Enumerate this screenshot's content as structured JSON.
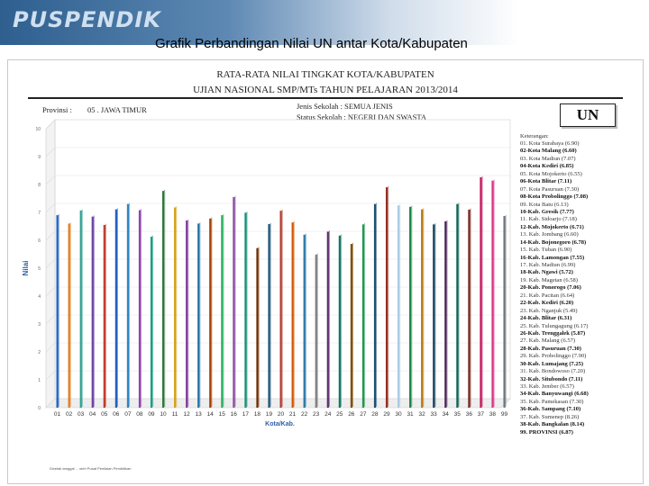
{
  "header": {
    "brand": "PUSPENDIK",
    "slide_title": "Grafik Perbandingan Nilai UN antar Kota/Kabupaten"
  },
  "report": {
    "title_line1": "RATA-RATA NILAI TINGKAT KOTA/KABUPATEN",
    "title_line2": "UJIAN NASIONAL SMP/MTs TAHUN PELAJARAN 2013/2014",
    "province_label": "Provinsi :",
    "province_value": "05 . JAWA TIMUR",
    "school_type": "Jenis Sekolah : SEMUA JENIS",
    "school_status": "Status Sekolah : NEGERI DAN SWASTA",
    "badge": "UN",
    "legend_heading": "Keterangan:",
    "footer_note": "Dicetak tanggal ... oleh Pusat Penilaian Pendidikan"
  },
  "chart_data": {
    "type": "bar",
    "ylabel": "Nilai",
    "xlabel": "Kota/Kab.",
    "ylim": [
      0,
      10
    ],
    "yticks": [
      0,
      1,
      2,
      3,
      4,
      5,
      6,
      7,
      8,
      9,
      10
    ],
    "grid": true,
    "legend_position": "right",
    "categories": [
      "01",
      "02",
      "03",
      "04",
      "05",
      "06",
      "07",
      "08",
      "09",
      "10",
      "11",
      "12",
      "13",
      "14",
      "15",
      "16",
      "17",
      "18",
      "19",
      "20",
      "21",
      "22",
      "23",
      "24",
      "25",
      "26",
      "27",
      "28",
      "29",
      "30",
      "31",
      "32",
      "33",
      "34",
      "35",
      "36",
      "37",
      "38",
      "99"
    ],
    "values": [
      6.9,
      6.6,
      7.07,
      6.85,
      6.55,
      7.11,
      7.3,
      7.08,
      6.13,
      7.77,
      7.18,
      6.71,
      6.6,
      6.78,
      6.9,
      7.55,
      6.99,
      5.72,
      6.58,
      7.06,
      6.64,
      6.2,
      5.49,
      6.31,
      6.17,
      5.87,
      6.57,
      7.3,
      7.9,
      7.25,
      7.2,
      7.11,
      6.57,
      6.68,
      7.3,
      7.1,
      8.26,
      8.14,
      6.87
    ],
    "legend": [
      "01. Kota Surabaya (6.90)",
      "02-Kota Malang (6.60)",
      "03. Kota Madiun (7.07)",
      "04-Kota Kediri (6.85)",
      "05. Kota Mojokerto (6.55)",
      "06-Kota Blitar (7.11)",
      "07. Kota Pasuruan (7.30)",
      "08-Kota Probolinggo (7.08)",
      "09. Kota Batu (6.13)",
      "10-Kab. Gresik (7.77)",
      "11. Kab. Sidoarjo (7.18)",
      "12-Kab. Mojokerto (6.71)",
      "13. Kab. Jombang (6.60)",
      "14-Kab. Bojonegoro (6.78)",
      "15. Kab. Tuban (6.90)",
      "16-Kab. Lamongan (7.55)",
      "17. Kab. Madiun (6.99)",
      "18-Kab. Ngawi (5.72)",
      "19. Kab. Magetan (6.58)",
      "20-Kab. Ponorogo (7.06)",
      "21. Kab. Pacitan (6.64)",
      "22-Kab. Kediri (6.20)",
      "23. Kab. Nganjuk (5.49)",
      "24-Kab. Blitar (6.31)",
      "25. Kab. Tulungagung (6.17)",
      "26-Kab. Trenggalek (5.87)",
      "27. Kab. Malang (6.57)",
      "28-Kab. Pasuruan (7.30)",
      "29. Kab. Probolinggo (7.90)",
      "30-Kab. Lumajang (7.25)",
      "31. Kab. Bondowoso (7.20)",
      "32-Kab. Situbondo (7.11)",
      "33. Kab. Jember (6.57)",
      "34-Kab. Banyuwangi (6.68)",
      "35. Kab. Pamekasan (7.30)",
      "36-Kab. Sampang (7.10)",
      "37. Kab. Sumenep (8.26)",
      "38-Kab. Bangkalan (8.14)",
      "99. PROVINSI (6.87)"
    ],
    "colors": [
      "#1f5fbf",
      "#e07b1a",
      "#2f9e8f",
      "#6a3fa0",
      "#c0392b",
      "#1f5fbf",
      "#2e86c1",
      "#8e44ad",
      "#16a085",
      "#2f7a3a",
      "#d4a017",
      "#7d3c98",
      "#2471a3",
      "#a04000",
      "#27ae60",
      "#884ea0",
      "#148f77",
      "#6e2c00",
      "#1a5276",
      "#b03a2e",
      "#d35400",
      "#2874a6",
      "#7b7d7d",
      "#5b2c6f",
      "#117864",
      "#7e5109",
      "#229954",
      "#1b4f72",
      "#943126",
      "#a9cce3",
      "#1d8348",
      "#b9770e",
      "#154360",
      "#4a235a",
      "#0e6655",
      "#78281f",
      "#c0185b",
      "#d63384",
      "#6c757d"
    ]
  }
}
